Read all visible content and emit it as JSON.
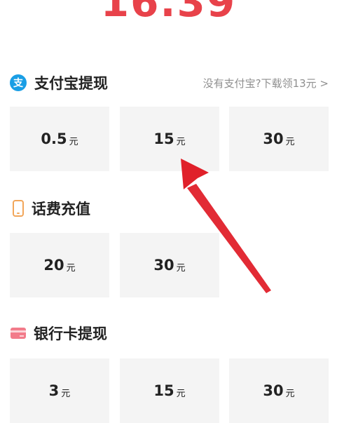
{
  "balance": "16.39",
  "alipay": {
    "icon": "alipay-icon",
    "icon_glyph": "支",
    "title": "支付宝提现",
    "link": "没有支付宝?下载领13元 >",
    "options": [
      {
        "amount": "0.5",
        "unit": "元"
      },
      {
        "amount": "15",
        "unit": "元"
      },
      {
        "amount": "30",
        "unit": "元"
      }
    ]
  },
  "phone": {
    "icon": "phone-icon",
    "title": "话费充值",
    "options": [
      {
        "amount": "20",
        "unit": "元"
      },
      {
        "amount": "30",
        "unit": "元"
      }
    ]
  },
  "bank": {
    "icon": "bank-card-icon",
    "title": "银行卡提现",
    "options": [
      {
        "amount": "3",
        "unit": "元"
      },
      {
        "amount": "15",
        "unit": "元"
      },
      {
        "amount": "30",
        "unit": "元"
      }
    ]
  },
  "colors": {
    "balance": "#e8424a",
    "alipay_icon": "#1a9ee5",
    "phone_icon": "#f2a65a",
    "bank_icon": "#f27b8a",
    "tile_bg": "#f4f4f4",
    "annotation_arrow": "#e0202a"
  }
}
